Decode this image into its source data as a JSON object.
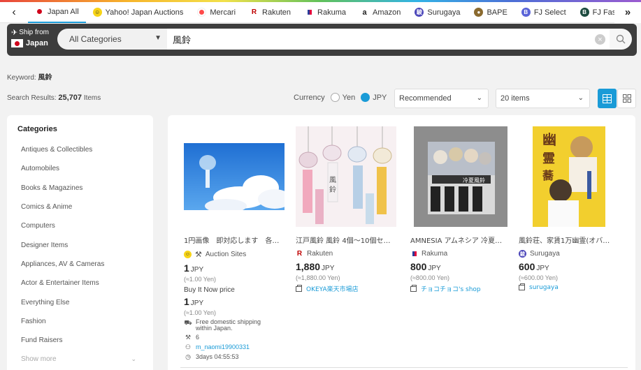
{
  "tabs": [
    {
      "label": "Japan All",
      "icon": "japan-flag-icon",
      "color": "#d0021b"
    },
    {
      "label": "Yahoo! Japan Auctions",
      "icon": "yahoo-auctions-icon",
      "color": "#f7d417"
    },
    {
      "label": "Mercari",
      "icon": "mercari-icon",
      "color": "#ff4a4a"
    },
    {
      "label": "Rakuten",
      "icon": "rakuten-icon",
      "color": "#bf0000"
    },
    {
      "label": "Rakuma",
      "icon": "rakuma-icon",
      "color": "#e2003b"
    },
    {
      "label": "Amazon",
      "icon": "amazon-icon",
      "color": "#222222"
    },
    {
      "label": "Surugaya",
      "icon": "surugaya-icon",
      "color": "#4b46b9"
    },
    {
      "label": "BAPE",
      "icon": "bape-icon",
      "color": "#8a6a2f"
    },
    {
      "label": "FJ Select",
      "icon": "fj-select-icon",
      "color": "#5a64d8"
    },
    {
      "label": "FJ Fashion",
      "icon": "fj-fashion-icon",
      "color": "#1c4b3f"
    }
  ],
  "search": {
    "ship_from_label": "Ship from",
    "ship_from_country": "Japan",
    "category": "All Categories",
    "query": "風鈴"
  },
  "keyword": {
    "label": "Keyword:",
    "value": "風鈴"
  },
  "results": {
    "label": "Search Results:",
    "count": "25,707",
    "unit": "Items"
  },
  "currency": {
    "label": "Currency",
    "options": [
      "Yen",
      "JPY"
    ],
    "selected": "JPY"
  },
  "sort": {
    "selected": "Recommended"
  },
  "per_page": {
    "selected": "20 items"
  },
  "sidebar": {
    "title": "Categories",
    "items": [
      "Antiques & Collectibles",
      "Automobiles",
      "Books & Magazines",
      "Comics & Anime",
      "Computers",
      "Designer Items",
      "Appliances, AV & Cameras",
      "Actor & Entertainer Items",
      "Everything Else",
      "Fashion",
      "Fund Raisers"
    ],
    "show_more": "Show more"
  },
  "products": [
    {
      "title": "1円画像　即対応します　各自…",
      "source": "Auction Sites",
      "price": "1",
      "currency": "JPY",
      "approx": "(≈1.00 Yen)",
      "buy_it_now_label": "Buy It Now price",
      "buy_it_now_price": "1",
      "buy_it_now_approx": "(≈1.00 Yen)",
      "shipping": "Free domestic shipping within Japan.",
      "bids": "6",
      "seller": "m_naomi19900331",
      "time_left": "3days 04:55:53"
    },
    {
      "title": "江戸風鈴 風鈴 4個〜10個セッ…",
      "source": "Rakuten",
      "price": "1,880",
      "currency": "JPY",
      "approx": "(≈1,880.00 Yen)",
      "shop": "OKEYA楽天市場店"
    },
    {
      "title": "AMNESIA アムネシア 冷夏風…",
      "source": "Rakuma",
      "price": "800",
      "currency": "JPY",
      "approx": "(≈800.00 Yen)",
      "shop": "チョコチョコ's shop"
    },
    {
      "title": "風鈴荘、家賃1万幽霊(オバケ)…",
      "source": "Surugaya",
      "price": "600",
      "currency": "JPY",
      "approx": "(≈600.00 Yen)",
      "shop": "surugaya"
    }
  ],
  "colors": {
    "accent": "#1a9bd7",
    "dark_bar": "#3d3d3d"
  }
}
